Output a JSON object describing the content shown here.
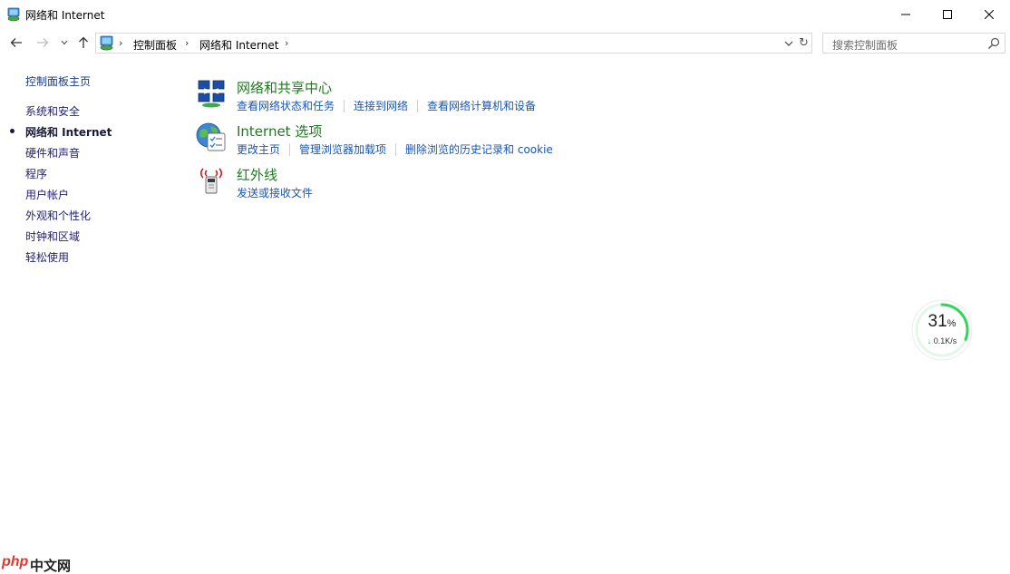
{
  "window": {
    "title": "网络和 Internet"
  },
  "address": {
    "crumbs": [
      "控制面板",
      "网络和 Internet"
    ],
    "separator": "›"
  },
  "search": {
    "placeholder": "搜索控制面板"
  },
  "sidebar": {
    "home": "控制面板主页",
    "items": [
      {
        "label": "系统和安全",
        "current": false
      },
      {
        "label": "网络和 Internet",
        "current": true
      },
      {
        "label": "硬件和声音",
        "current": false
      },
      {
        "label": "程序",
        "current": false
      },
      {
        "label": "用户帐户",
        "current": false
      },
      {
        "label": "外观和个性化",
        "current": false
      },
      {
        "label": "时钟和区域",
        "current": false
      },
      {
        "label": "轻松使用",
        "current": false
      }
    ]
  },
  "categories": [
    {
      "title": "网络和共享中心",
      "icon": "network-sharing-icon",
      "links": [
        "查看网络状态和任务",
        "连接到网络",
        "查看网络计算机和设备"
      ]
    },
    {
      "title": "Internet 选项",
      "icon": "internet-options-icon",
      "links": [
        "更改主页",
        "管理浏览器加载项",
        "删除浏览的历史记录和 cookie"
      ]
    },
    {
      "title": "红外线",
      "icon": "infrared-icon",
      "links": [
        "发送或接收文件"
      ]
    }
  ],
  "speed_widget": {
    "percent": "31",
    "percent_unit": "%",
    "rate_arrow": "↓",
    "rate": "0.1K/s",
    "progress": 0.31
  },
  "watermark": {
    "brand": "php",
    "site": "中文网"
  },
  "colors": {
    "category_title": "#1e7a1e",
    "link": "#1a56b5",
    "gauge": "#2fd65a"
  }
}
